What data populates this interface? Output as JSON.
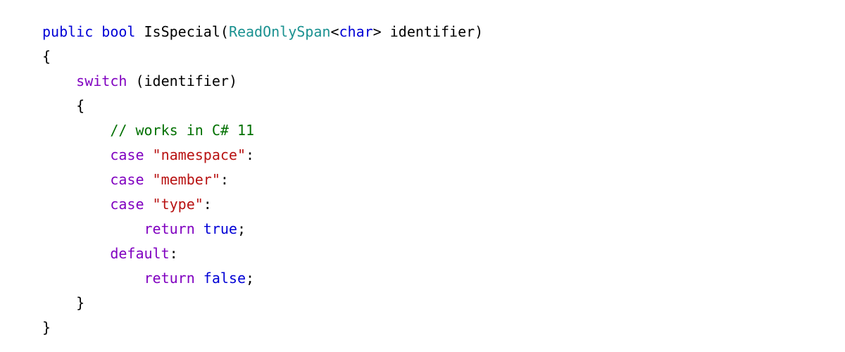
{
  "code": {
    "lang": "csharp",
    "sig": {
      "access": "public",
      "ret": "bool",
      "name": "IsSpecial",
      "ptype": "ReadOnlySpan",
      "pinner": "char",
      "pname": "identifier"
    },
    "sw": {
      "kw": "switch",
      "expr": "identifier"
    },
    "comment": "// works in C# 11",
    "cases": {
      "kw": "case",
      "v0": "\"namespace\"",
      "v1": "\"member\"",
      "v2": "\"type\""
    },
    "ret1": {
      "kw": "return",
      "val": "true"
    },
    "def": {
      "kw": "default"
    },
    "ret2": {
      "kw": "return",
      "val": "false"
    },
    "br": {
      "open": "{",
      "close": "}"
    },
    "p": {
      "open": "(",
      "close": ")",
      "lt": "<",
      "gt": ">",
      "colon": ":",
      "semi": ";"
    }
  }
}
